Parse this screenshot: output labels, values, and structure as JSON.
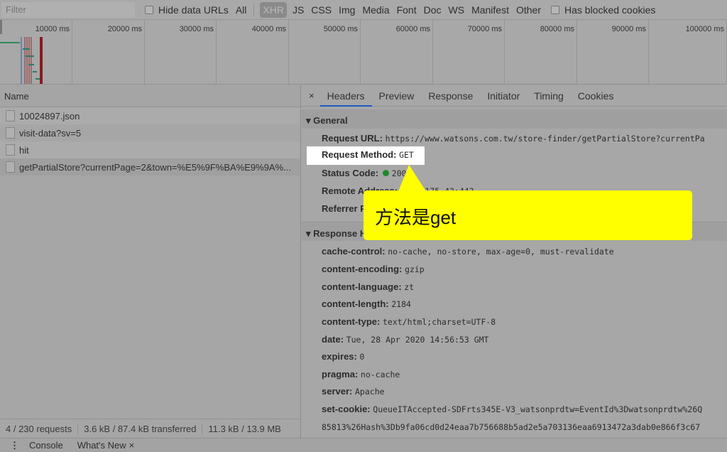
{
  "toolbar": {
    "filter_placeholder": "Filter",
    "hide_data_urls": "Hide data URLs",
    "types": [
      "All",
      "XHR",
      "JS",
      "CSS",
      "Img",
      "Media",
      "Font",
      "Doc",
      "WS",
      "Manifest",
      "Other"
    ],
    "active_type": "XHR",
    "blocked_cookies": "Has blocked cookies"
  },
  "overview": {
    "ticks": [
      "10000 ms",
      "20000 ms",
      "30000 ms",
      "40000 ms",
      "50000 ms",
      "60000 ms",
      "70000 ms",
      "80000 ms",
      "90000 ms",
      "100000 ms"
    ]
  },
  "requests": {
    "header": "Name",
    "items": [
      "10024897.json",
      "visit-data?sv=5",
      "hit",
      "getPartialStore?currentPage=2&town=%E5%9F%BA%E9%9A%..."
    ]
  },
  "status": {
    "requests": "4 / 230 requests",
    "transferred": "3.6 kB / 87.4 kB transferred",
    "resources": "11.3 kB / 13.9 MB"
  },
  "detail": {
    "close": "×",
    "tabs": [
      "Headers",
      "Preview",
      "Response",
      "Initiator",
      "Timing",
      "Cookies"
    ],
    "active_tab": "Headers",
    "general_title": "General",
    "general": [
      {
        "k": "Request URL:",
        "v": "https://www.watsons.com.tw/store-finder/getPartialStore?currentPa"
      },
      {
        "k": "Request Method:",
        "v": "GET"
      },
      {
        "k": "Status Code:",
        "v": "200"
      },
      {
        "k": "Remote Address:",
        "v": "...1.175.43:443"
      },
      {
        "k": "Referrer P",
        "v": ""
      }
    ],
    "response_title": "Response H",
    "response": [
      {
        "k": "cache-control:",
        "v": "no-cache, no-store, max-age=0, must-revalidate"
      },
      {
        "k": "content-encoding:",
        "v": "gzip"
      },
      {
        "k": "content-language:",
        "v": "zt"
      },
      {
        "k": "content-length:",
        "v": "2184"
      },
      {
        "k": "content-type:",
        "v": "text/html;charset=UTF-8"
      },
      {
        "k": "date:",
        "v": "Tue, 28 Apr 2020 14:56:53 GMT"
      },
      {
        "k": "expires:",
        "v": "0"
      },
      {
        "k": "pragma:",
        "v": "no-cache"
      },
      {
        "k": "server:",
        "v": "Apache"
      },
      {
        "k": "set-cookie:",
        "v": "QueueITAccepted-SDFrts345E-V3_watsonprdtw=EventId%3Dwatsonprdtw%26Q"
      }
    ],
    "cookie_cont": "85813%26Hash%3Db9fa06cd0d24eaa7b756688b5ad2e5a703136eaa6913472a3dab0e866f3c67"
  },
  "drawer": {
    "menu": "⋮",
    "tabs": [
      "Console",
      "What's New"
    ],
    "close": "×"
  },
  "callout": {
    "text": "方法是get",
    "color": "#ffff00"
  }
}
